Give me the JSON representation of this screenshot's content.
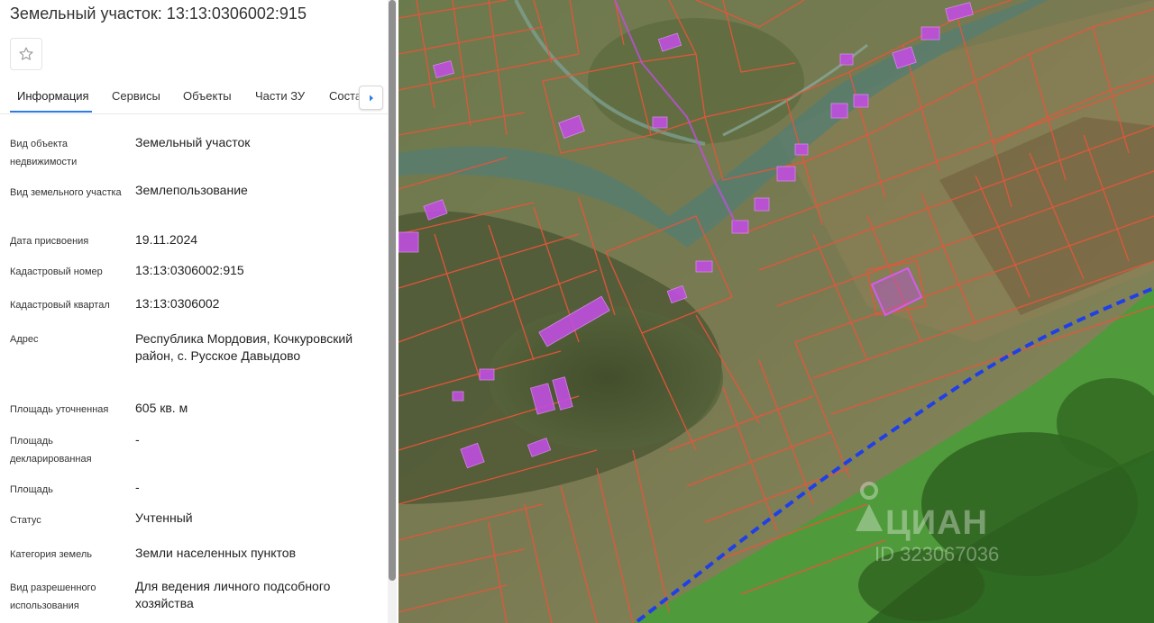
{
  "parcel": {
    "title": "Земельный участок: 13:13:0306002:915"
  },
  "tabs": [
    {
      "label": "Информация"
    },
    {
      "label": "Сервисы"
    },
    {
      "label": "Объекты"
    },
    {
      "label": "Части ЗУ"
    },
    {
      "label": "Состав ЗУ"
    }
  ],
  "details": [
    {
      "label": "Вид объекта недвижимости",
      "value": "Земельный участок"
    },
    {
      "label": "Вид земельного участка",
      "value": "Землепользование"
    },
    {
      "label": "Дата присвоения",
      "value": "19.11.2024"
    },
    {
      "label": "Кадастровый номер",
      "value": "13:13:0306002:915"
    },
    {
      "label": "Кадастровый квартал",
      "value": "13:13:0306002"
    },
    {
      "label": "Адрес",
      "value": "Республика Мордовия, Кочкуровский район, с. Русское Давыдово"
    },
    {
      "label": "Площадь уточненная",
      "value": "605 кв. м"
    },
    {
      "label": "Площадь декларированная",
      "value": "-"
    },
    {
      "label": "Площадь",
      "value": "-"
    },
    {
      "label": "Статус",
      "value": "Учтенный"
    },
    {
      "label": "Категория земель",
      "value": "Земли населенных пунктов"
    },
    {
      "label": "Вид разрешенного использования",
      "value": "Для ведения личного подсобного хозяйства"
    }
  ],
  "icons": {
    "favorite": "star-outline-icon",
    "tabs_next": "chevron-right-icon"
  },
  "map": {
    "watermark_brand": "ЦИАН",
    "watermark_id": "ID 323067036",
    "colors": {
      "parcel_border": "#e8553a",
      "building": "#c04fe0",
      "boundary": "#1f3fe8"
    }
  }
}
